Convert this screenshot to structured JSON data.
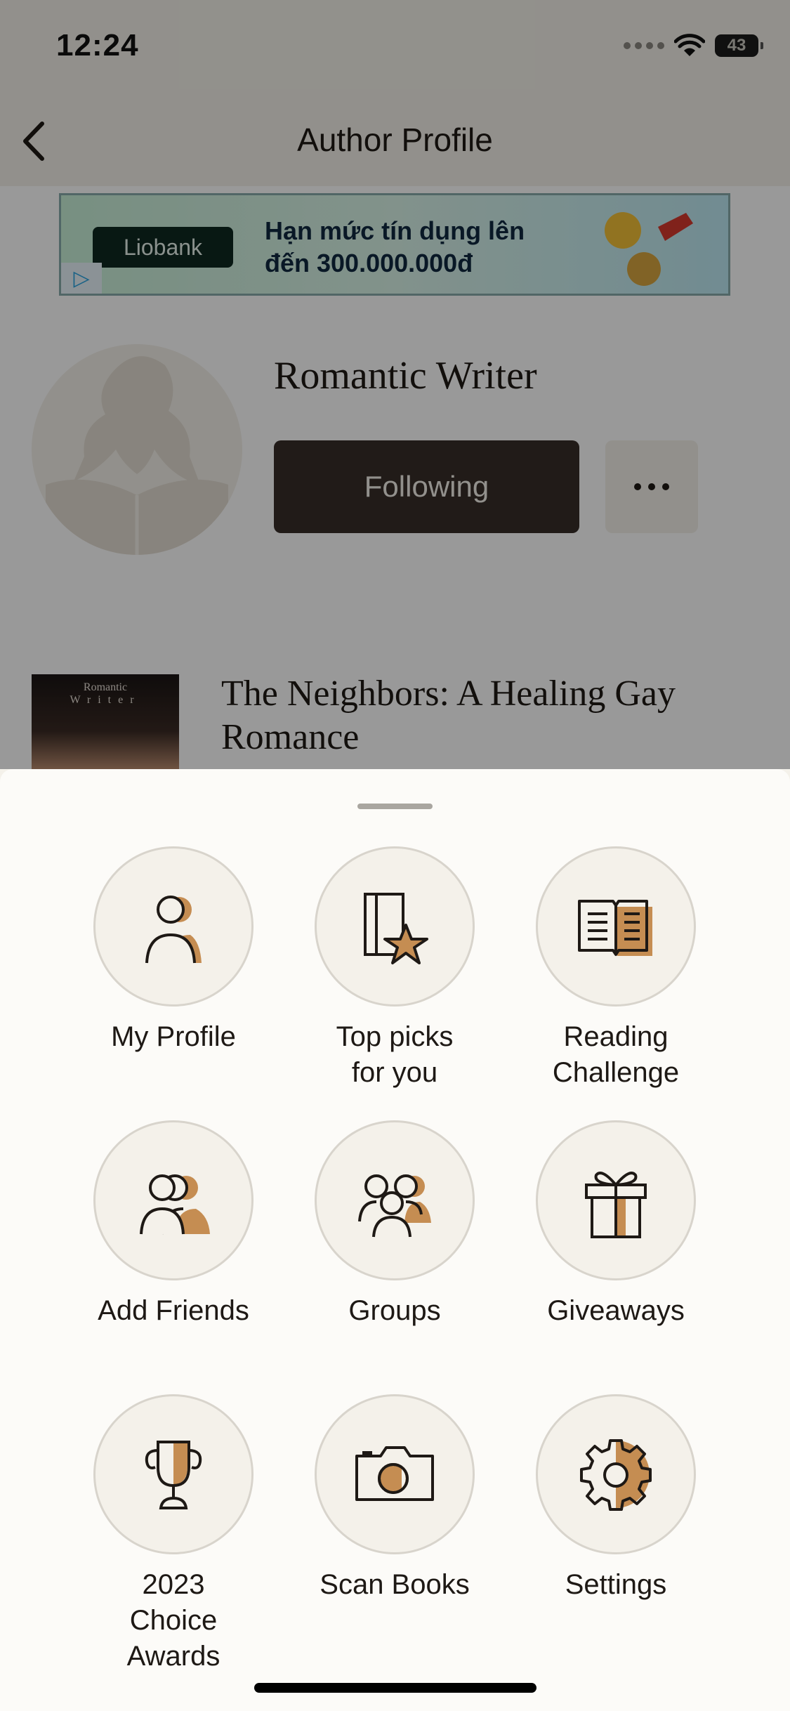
{
  "status_bar": {
    "time": "12:24",
    "battery": "43"
  },
  "nav": {
    "title": "Author Profile"
  },
  "ad": {
    "brand": "Liobank",
    "line1": "Hạn mức tín dụng lên",
    "line2": "đến 300.000.000đ"
  },
  "author": {
    "name": "Romantic Writer",
    "follow_label": "Following"
  },
  "book": {
    "title": "The Neighbors: A Healing Gay Romance",
    "cover_line1": "Romantic",
    "cover_line2": "Writer"
  },
  "menu": {
    "items": [
      {
        "label": "My Profile",
        "icon": "profile-icon"
      },
      {
        "label": "Top picks\nfor you",
        "icon": "top-picks-icon"
      },
      {
        "label": "Reading\nChallenge",
        "icon": "open-book-icon"
      },
      {
        "label": "Add Friends",
        "icon": "add-friends-icon"
      },
      {
        "label": "Groups",
        "icon": "groups-icon"
      },
      {
        "label": "Giveaways",
        "icon": "gift-icon"
      },
      {
        "label": "2023\nChoice\nAwards",
        "icon": "trophy-icon"
      },
      {
        "label": "Scan Books",
        "icon": "camera-icon"
      },
      {
        "label": "Settings",
        "icon": "gear-icon"
      }
    ]
  },
  "colors": {
    "accent": "#c58d52",
    "ink": "#1e1915",
    "button_dark": "#382e29",
    "surface": "#f4f1ea"
  }
}
